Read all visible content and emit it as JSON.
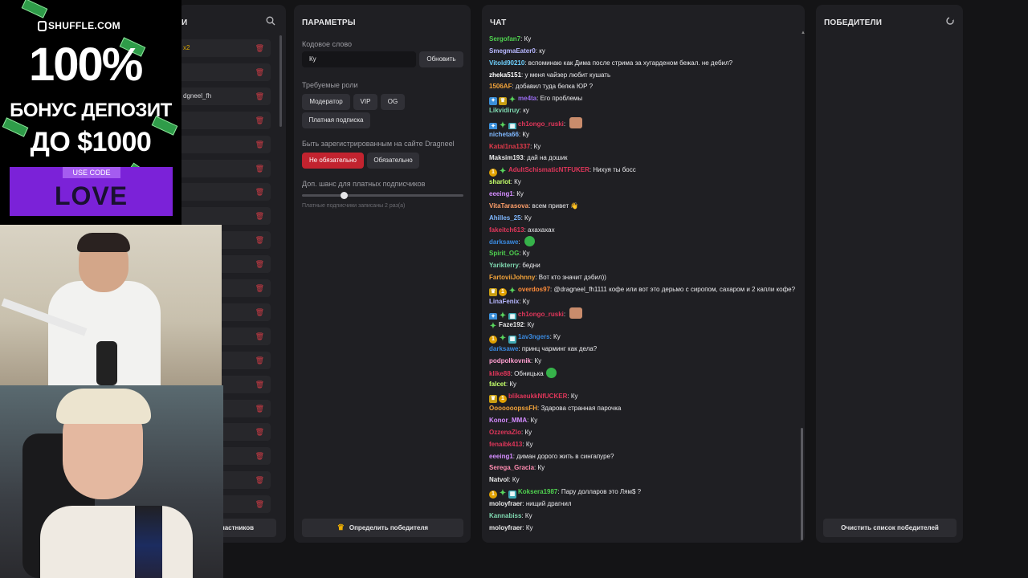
{
  "participants": {
    "title_visible": "И",
    "rows": [
      {
        "name": "",
        "mult": "x2"
      },
      {
        "name": "",
        "mult": ""
      },
      {
        "name": "dgneel_fh",
        "mult": ""
      },
      {
        "name": "",
        "mult": ""
      },
      {
        "name": "",
        "mult": ""
      },
      {
        "name": "",
        "mult": ""
      },
      {
        "name": "",
        "mult": ""
      },
      {
        "name": "",
        "mult": ""
      },
      {
        "name": "",
        "mult": ""
      },
      {
        "name": "",
        "mult": ""
      },
      {
        "name": "",
        "mult": ""
      },
      {
        "name": "",
        "mult": ""
      },
      {
        "name": "",
        "mult": ""
      },
      {
        "name": "",
        "mult": ""
      },
      {
        "name": "",
        "mult": ""
      },
      {
        "name": "",
        "mult": ""
      },
      {
        "name": "",
        "mult": ""
      },
      {
        "name": "",
        "mult": ""
      },
      {
        "name": "",
        "mult": ""
      },
      {
        "name": "",
        "mult": ""
      }
    ],
    "bottom_button": "частников"
  },
  "params": {
    "title": "ПАРАМЕТРЫ",
    "keyword_label": "Кодовое слово",
    "keyword_value": "Ку",
    "update_button": "Обновить",
    "roles_label": "Требуемые роли",
    "roles": [
      "Модератор",
      "VIP",
      "OG",
      "Платная подписка"
    ],
    "registered_label": "Быть зарегистрированным на сайте Dragneel",
    "not_required": "Не обязательно",
    "required": "Обязательно",
    "chance_label": "Доп. шанс для платных подписчиков",
    "chance_hint": "Платные подписчики записаны 2 раз(а)",
    "chance_fraction": 0.25,
    "pick_winner": "Определить победителя"
  },
  "chat": {
    "title": "ЧАТ",
    "messages": [
      {
        "badges": [],
        "user": "Sergofan7",
        "color": "#4fd14f",
        "text": "Ку"
      },
      {
        "badges": [],
        "user": "SmegmaEater0",
        "color": "#b7b7ff",
        "text": "ку"
      },
      {
        "badges": [],
        "user": "Vitold90210",
        "color": "#6fd1ff",
        "text": "вспоминаю как Дима после стрима за хугарденом бежал. не дебил?"
      },
      {
        "badges": [],
        "user": "zheka5151",
        "color": "#ffffff",
        "text": "у меня чайзер любит кушать"
      },
      {
        "badges": [],
        "user": "1506AF",
        "color": "#f2a33a",
        "text": "добавил туда белка ЮР ?"
      },
      {
        "badges": [
          "prime",
          "sub",
          "star"
        ],
        "user": "me4ta",
        "color": "#9a6cf0",
        "text": "Его проблемы"
      },
      {
        "badges": [],
        "user": "Likvidiruy",
        "color": "#7fd8b0",
        "text": "ку"
      },
      {
        "badges": [
          "prime",
          "star",
          "gift"
        ],
        "user": "ch1ongo_ruski",
        "color": "#e0365a",
        "text": "",
        "emote": "brown"
      },
      {
        "badges": [],
        "user": "nicheta66",
        "color": "#7fb8ff",
        "text": "Ку"
      },
      {
        "badges": [],
        "user": "Katal1na1337",
        "color": "#e23a4a",
        "text": "Ку"
      },
      {
        "badges": [],
        "user": "Maksim193",
        "color": "#e8e8e8",
        "text": "дай на  дошик"
      },
      {
        "badges": [
          "coin",
          "star"
        ],
        "user": "AdultSchismaticNTFUKER",
        "color": "#e0365a",
        "text": "Нихуя ты босс"
      },
      {
        "badges": [],
        "user": "sharlot",
        "color": "#c4ff6a",
        "text": "Ку"
      },
      {
        "badges": [],
        "user": "eeeing1",
        "color": "#d48cff",
        "text": "Ку"
      },
      {
        "badges": [],
        "user": "VitaTarasova",
        "color": "#ff9f6a",
        "text": "всем привет 👋"
      },
      {
        "badges": [],
        "user": "Ahilles_25",
        "color": "#7fb8ff",
        "text": "Ку"
      },
      {
        "badges": [],
        "user": "fakeitch613",
        "color": "#e0365a",
        "text": "ахахахах"
      },
      {
        "badges": [],
        "user": "darksawe",
        "color": "#3a8ae0",
        "text": "",
        "emote": "green"
      },
      {
        "badges": [],
        "user": "Spirit_OG",
        "color": "#4fd14f",
        "text": "Ку"
      },
      {
        "badges": [],
        "user": "Yarikterry",
        "color": "#7fd8b0",
        "text": "бедни"
      },
      {
        "badges": [],
        "user": "FartoviiJohnny",
        "color": "#f2a33a",
        "text": "Вот кто значит дэбил))"
      },
      {
        "badges": [
          "sub",
          "coin",
          "star"
        ],
        "user": "overdos97",
        "color": "#ff8c3a",
        "text": "@dragneel_fh1111 кофе или вот это дерьмо с сиропом, сахаром и 2 капли кофе?"
      },
      {
        "badges": [],
        "user": "LinaFenix",
        "color": "#b7b7ff",
        "text": "Ку"
      },
      {
        "badges": [
          "prime",
          "star",
          "gift"
        ],
        "user": "ch1ongo_ruski",
        "color": "#e0365a",
        "text": "",
        "emote": "brown"
      },
      {
        "badges": [
          "star"
        ],
        "user": "Faze192",
        "color": "#e8e8e8",
        "text": "Ку"
      },
      {
        "badges": [
          "coin",
          "star",
          "gift"
        ],
        "user": "1av3ngers",
        "color": "#3a8ae0",
        "text": "Ку"
      },
      {
        "badges": [],
        "user": "darksawe",
        "color": "#3a8ae0",
        "text": "принц чарминг как дела?"
      },
      {
        "badges": [],
        "user": "podpolkovnik",
        "color": "#ff9fd0",
        "text": "Ку"
      },
      {
        "badges": [],
        "user": "klike88",
        "color": "#e0365a",
        "text": "Обницька",
        "emote": "green"
      },
      {
        "badges": [],
        "user": "falcet",
        "color": "#c4ff6a",
        "text": "Ку"
      },
      {
        "badges": [
          "sub",
          "coin"
        ],
        "user": "blikaeukkNfUCKER",
        "color": "#e0365a",
        "text": "Ку"
      },
      {
        "badges": [],
        "user": "OoooooopssFH",
        "color": "#f2a33a",
        "text": "Здарова странная парочка"
      },
      {
        "badges": [],
        "user": "Konor_MMA",
        "color": "#d48cff",
        "text": "Ку"
      },
      {
        "badges": [],
        "user": "OzzenaZlo",
        "color": "#e0365a",
        "text": "Ку"
      },
      {
        "badges": [],
        "user": "fenaibk413",
        "color": "#e0365a",
        "text": "Ку"
      },
      {
        "badges": [],
        "user": "eeeing1",
        "color": "#d48cff",
        "text": "диман дорого жить в сингапуре?"
      },
      {
        "badges": [],
        "user": "Serega_Gracia",
        "color": "#ff8cb0",
        "text": "Ку"
      },
      {
        "badges": [],
        "user": "Natvol",
        "color": "#e8e8e8",
        "text": "Ку"
      },
      {
        "badges": [
          "coin",
          "star",
          "gift"
        ],
        "user": "Koksera1987",
        "color": "#4fd14f",
        "text": "Пару долларов это Лям$ ?"
      },
      {
        "badges": [],
        "user": "moloyfraer",
        "color": "#e8e8e8",
        "text": "нищий драгнил"
      },
      {
        "badges": [],
        "user": "Kannabiss",
        "color": "#7fd8b0",
        "text": "Ку"
      },
      {
        "badges": [],
        "user": "moloyfraer",
        "color": "#e8e8e8",
        "text": "Ку"
      }
    ]
  },
  "winners": {
    "title": "ПОБЕДИТЕЛИ",
    "clear_button": "Очистить список победителей"
  },
  "overlay": {
    "logo": "SHUFFLE.COM",
    "big": "100%",
    "bonus_line1": "БОНУС ДЕПОЗИТ",
    "bonus_line2": "ДО $1000",
    "code_tag": "USE CODE",
    "code": "LOVE"
  }
}
